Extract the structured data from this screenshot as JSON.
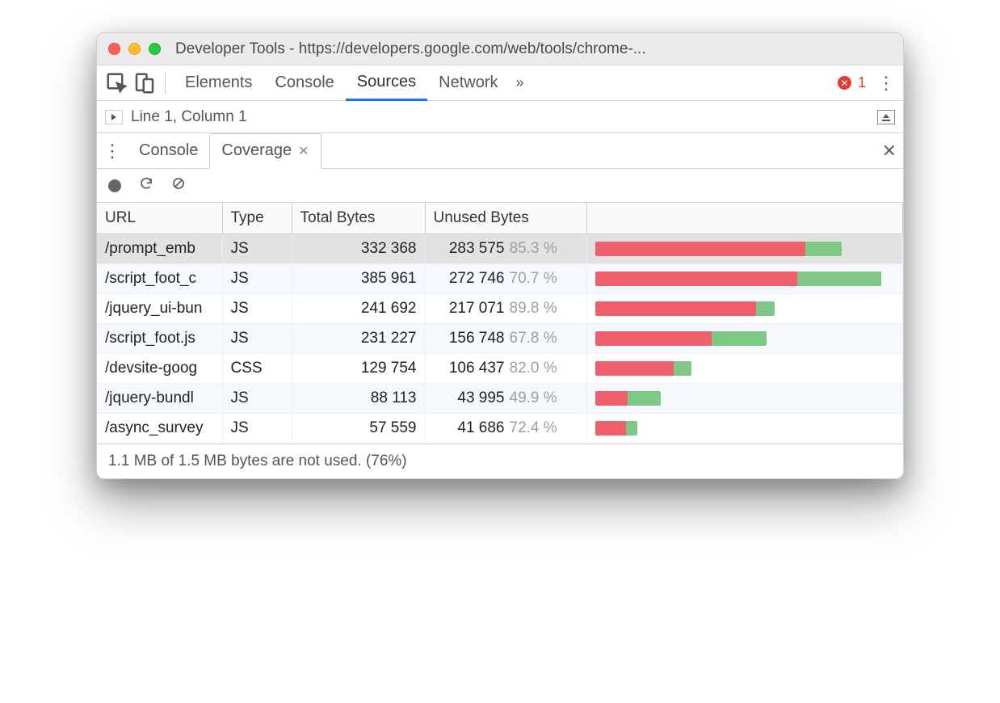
{
  "window": {
    "title": "Developer Tools - https://developers.google.com/web/tools/chrome-..."
  },
  "tabs": {
    "items": [
      "Elements",
      "Console",
      "Sources",
      "Network"
    ],
    "active_index": 2,
    "more_glyph": "»",
    "error_count": "1"
  },
  "source": {
    "line_col": "Line 1, Column 1"
  },
  "drawer": {
    "tabs": [
      "Console",
      "Coverage"
    ],
    "active_index": 1
  },
  "coverage": {
    "headers": [
      "URL",
      "Type",
      "Total Bytes",
      "Unused Bytes"
    ],
    "max_total": 385961,
    "rows": [
      {
        "url": "/prompt_emb",
        "type": "JS",
        "total": "332 368",
        "total_n": 332368,
        "unused": "283 575",
        "unused_n": 283575,
        "pct": "85.3 %",
        "pct_n": 85.3,
        "selected": true
      },
      {
        "url": "/script_foot_c",
        "type": "JS",
        "total": "385 961",
        "total_n": 385961,
        "unused": "272 746",
        "unused_n": 272746,
        "pct": "70.7 %",
        "pct_n": 70.7,
        "alt": true
      },
      {
        "url": "/jquery_ui-bun",
        "type": "JS",
        "total": "241 692",
        "total_n": 241692,
        "unused": "217 071",
        "unused_n": 217071,
        "pct": "89.8 %",
        "pct_n": 89.8
      },
      {
        "url": "/script_foot.js",
        "type": "JS",
        "total": "231 227",
        "total_n": 231227,
        "unused": "156 748",
        "unused_n": 156748,
        "pct": "67.8 %",
        "pct_n": 67.8,
        "alt": true
      },
      {
        "url": "/devsite-goog",
        "type": "CSS",
        "total": "129 754",
        "total_n": 129754,
        "unused": "106 437",
        "unused_n": 106437,
        "pct": "82.0 %",
        "pct_n": 82.0
      },
      {
        "url": "/jquery-bundl",
        "type": "JS",
        "total": "88 113",
        "total_n": 88113,
        "unused": "43 995",
        "unused_n": 43995,
        "pct": "49.9 %",
        "pct_n": 49.9,
        "alt": true
      },
      {
        "url": "/async_survey",
        "type": "JS",
        "total": "57 559",
        "total_n": 57559,
        "unused": "41 686",
        "unused_n": 41686,
        "pct": "72.4 %",
        "pct_n": 72.4
      }
    ],
    "summary": "1.1 MB of 1.5 MB bytes are not used. (76%)"
  }
}
